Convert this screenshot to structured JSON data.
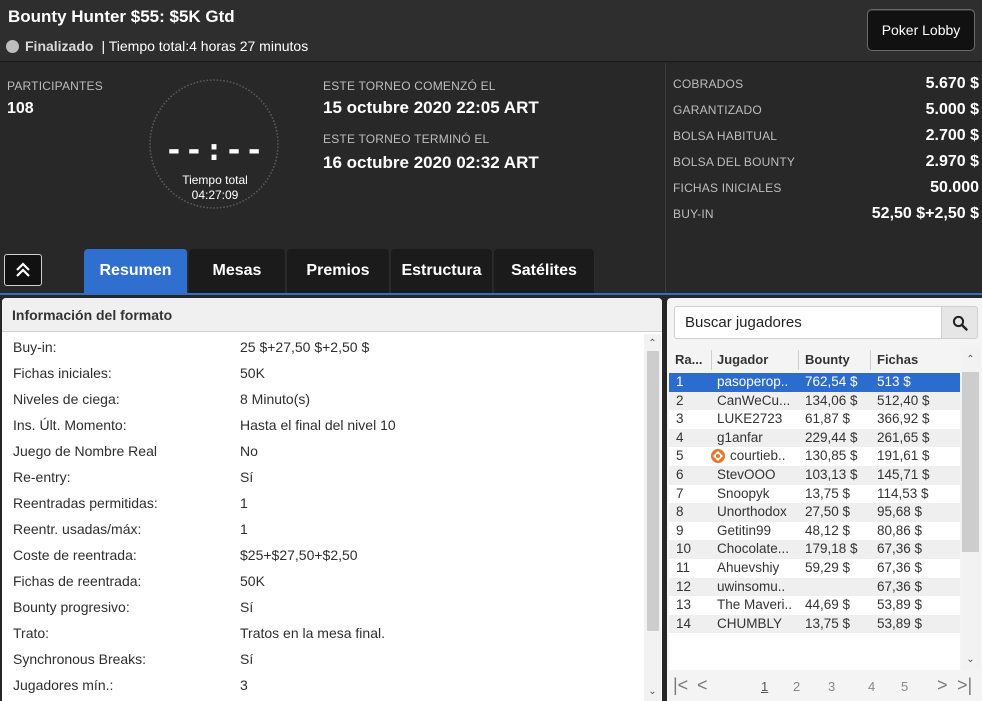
{
  "header": {
    "title": "Bounty Hunter $55: $5K Gtd",
    "status": "Finalizado",
    "total_time_text": "| Tiempo total:4 horas  27 minutos",
    "lobby_button": "Poker Lobby"
  },
  "info": {
    "participants_label": "PARTICIPANTES",
    "participants_value": "108",
    "clock_digits": "--:--",
    "clock_label": "Tiempo total",
    "clock_time": "04:27:09",
    "started_label": "ESTE TORNEO COMENZó EL",
    "started_value": "15 octubre 2020  22:05 ART",
    "ended_label": "ESTE TORNEO TERMINó EL",
    "ended_value": "16 octubre 2020  02:32 ART"
  },
  "stats": [
    {
      "label": "COBRADOS",
      "value": "5.670 $"
    },
    {
      "label": "GARANTIZADO",
      "value": "5.000 $"
    },
    {
      "label": "BOLSA HABITUAL",
      "value": "2.700 $"
    },
    {
      "label": "BOLSA DEL BOUNTY",
      "value": "2.970 $"
    },
    {
      "label": "FICHAS INICIALES",
      "value": "50.000"
    },
    {
      "label": "BUY-IN",
      "value": "52,50 $+2,50 $"
    }
  ],
  "tabs": [
    {
      "label": "Resumen",
      "active": true
    },
    {
      "label": "Mesas"
    },
    {
      "label": "Premios"
    },
    {
      "label": "Estructura"
    },
    {
      "label": "Satélites"
    }
  ],
  "format": {
    "title": "Información del formato",
    "rows": [
      {
        "key": "Buy-in:",
        "value": "25 $+27,50 $+2,50 $"
      },
      {
        "key": "Fichas iniciales:",
        "value": "50K"
      },
      {
        "key": "Niveles de ciega:",
        "value": "8 Minuto(s)"
      },
      {
        "key": "Ins. Últ. Momento:",
        "value": "Hasta el final del nivel 10"
      },
      {
        "key": "Juego de Nombre Real",
        "value": "No"
      },
      {
        "key": "Re-entry:",
        "value": "Sí"
      },
      {
        "key": "Reentradas permitidas:",
        "value": "1"
      },
      {
        "key": "Reentr. usadas/máx:",
        "value": "1"
      },
      {
        "key": "Coste de reentrada:",
        "value": "$25+$27,50+$2,50"
      },
      {
        "key": "Fichas de reentrada:",
        "value": "50K"
      },
      {
        "key": "Bounty progresivo:",
        "value": "Sí"
      },
      {
        "key": "Trato:",
        "value": "Tratos en la mesa final."
      },
      {
        "key": "Synchronous Breaks:",
        "value": "Sí"
      },
      {
        "key": "Jugadores mín.:",
        "value": "3"
      }
    ]
  },
  "players": {
    "search_placeholder": "Buscar jugadores",
    "columns": [
      "Ra...",
      "Jugador",
      "Bounty",
      "Fichas"
    ],
    "rows": [
      {
        "rank": "1",
        "name": "pasoperop..",
        "bounty": "762,54 $",
        "chips": "513 $"
      },
      {
        "rank": "2",
        "name": "CanWeCu...",
        "bounty": "134,06 $",
        "chips": "512,40 $"
      },
      {
        "rank": "3",
        "name": "LUKE2723",
        "bounty": "61,87 $",
        "chips": "366,92 $"
      },
      {
        "rank": "4",
        "name": "g1anfar",
        "bounty": "229,44 $",
        "chips": "261,65 $"
      },
      {
        "rank": "5",
        "name": "courtieb..",
        "bounty": "130,85 $",
        "chips": "191,61 $",
        "badge": true
      },
      {
        "rank": "6",
        "name": "StevOOO",
        "bounty": "103,13 $",
        "chips": "145,71 $"
      },
      {
        "rank": "7",
        "name": "Snoopyk",
        "bounty": "13,75 $",
        "chips": "114,53 $"
      },
      {
        "rank": "8",
        "name": "Unorthodox",
        "bounty": "27,50 $",
        "chips": "95,68 $"
      },
      {
        "rank": "9",
        "name": "Getitin99",
        "bounty": "48,12 $",
        "chips": "80,86 $"
      },
      {
        "rank": "10",
        "name": "Chocolate...",
        "bounty": "179,18 $",
        "chips": "67,36 $"
      },
      {
        "rank": "11",
        "name": "Ahuevshiy",
        "bounty": "59,29 $",
        "chips": "67,36 $"
      },
      {
        "rank": "12",
        "name": "uwinsomu..",
        "bounty": "",
        "chips": "67,36 $"
      },
      {
        "rank": "13",
        "name": "The Maveri..",
        "bounty": "44,69 $",
        "chips": "53,89 $"
      },
      {
        "rank": "14",
        "name": "CHUMBLY",
        "bounty": "13,75 $",
        "chips": "53,89 $"
      }
    ],
    "pages": [
      "1",
      "2",
      "3",
      "4",
      "5"
    ]
  },
  "colors": {
    "accent": "#2f6fd0",
    "header_bg": "#2e2e2e",
    "panel_bg": "#282828"
  }
}
